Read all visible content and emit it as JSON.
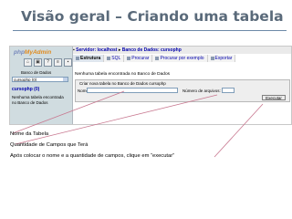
{
  "slide": {
    "title": "Visão geral – Criando uma tabela"
  },
  "left_pane": {
    "logo_php": "php",
    "logo_admin": "MyAdmin",
    "icons": [
      "home-icon",
      "sql-window-icon",
      "docs-icon",
      "sql-icon",
      "exit-icon"
    ],
    "db_label": "Banco de Dados",
    "db_select_value": "cursophp (0)",
    "db_name": "cursophp (0)",
    "no_tables_text": "Nenhuma tabela encontrada no Banco de Dados"
  },
  "breadcrumb": {
    "server_label": "Servidor: localhost",
    "db_label": "Banco de Dados: cursophp"
  },
  "tabs": [
    {
      "label": "Estrutura",
      "active": true
    },
    {
      "label": "SQL",
      "active": false
    },
    {
      "label": "Procurar",
      "active": false
    },
    {
      "label": "Procurar por exemplo",
      "active": false
    },
    {
      "label": "Exportar",
      "active": false
    }
  ],
  "main": {
    "message": "Nenhuma tabela encontrada no Banco de Dados",
    "create_legend": "Criar nova tabela no Banco de Dados cursophp",
    "name_label": "Nome:",
    "name_value": "",
    "fields_label": "Número de arquivos:",
    "fields_value": "",
    "execute_label": "Executar"
  },
  "captions": {
    "table_name": "Nome da Tabela",
    "field_count": "Quantidade de Campos que Terá",
    "instruction": "Após colocar o nome e a quantidade de campos, clique em “executar”"
  },
  "colors": {
    "title": "#5a6a7a",
    "rule": "#6d8aa8",
    "arrow": "#c87890",
    "left_pane_bg": "#d0dce0"
  }
}
